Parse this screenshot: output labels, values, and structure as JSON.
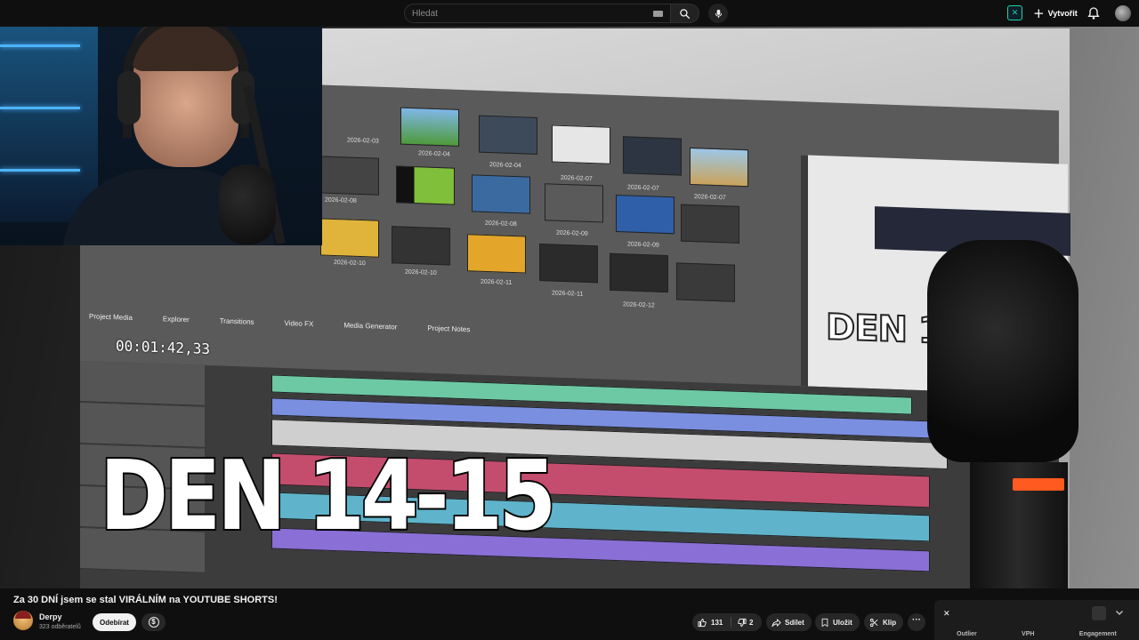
{
  "header": {
    "search_placeholder": "Hledat",
    "create_label": "Vytvořit"
  },
  "video_overlay": {
    "main_text": "DEN 14-15",
    "preview_text": "DEN 1",
    "timecode": "00:01:42,33",
    "panel_tabs": [
      "Project Media",
      "Explorer",
      "Transitions",
      "Video FX",
      "Media Generator",
      "Project Notes"
    ],
    "clip_dates": [
      "2026-02-03",
      "2026-02-04",
      "2026-02-04",
      "2026-02-07",
      "2026-02-07",
      "2026-02-07",
      "2026-02-08",
      "2026-02-08",
      "2026-02-09",
      "2026-02-09",
      "2026-02-10",
      "2026-02-10",
      "2026-02-11",
      "2026-02-11",
      "2026-02-12"
    ]
  },
  "video": {
    "title": "Za 30 DNÍ jsem se stal VIRÁLNÍM na YOUTUBE SHORTS!"
  },
  "channel": {
    "name": "Derpy",
    "subscribers": "323 odběratelů",
    "subscribe_label": "Odebírat"
  },
  "actions": {
    "like_count": "131",
    "dislike_count": "2",
    "share_label": "Sdílet",
    "save_label": "Uložit",
    "clip_label": "Klip"
  },
  "extension": {
    "tabs": [
      "Outlier",
      "VPH",
      "Engagement"
    ]
  },
  "colors": {
    "background": "#0f0f0f",
    "pill": "#272727",
    "subscribe_bg": "#f1f1f1",
    "ext_accent": "#1fd6a5",
    "mic_led": "#ff5a1f"
  }
}
